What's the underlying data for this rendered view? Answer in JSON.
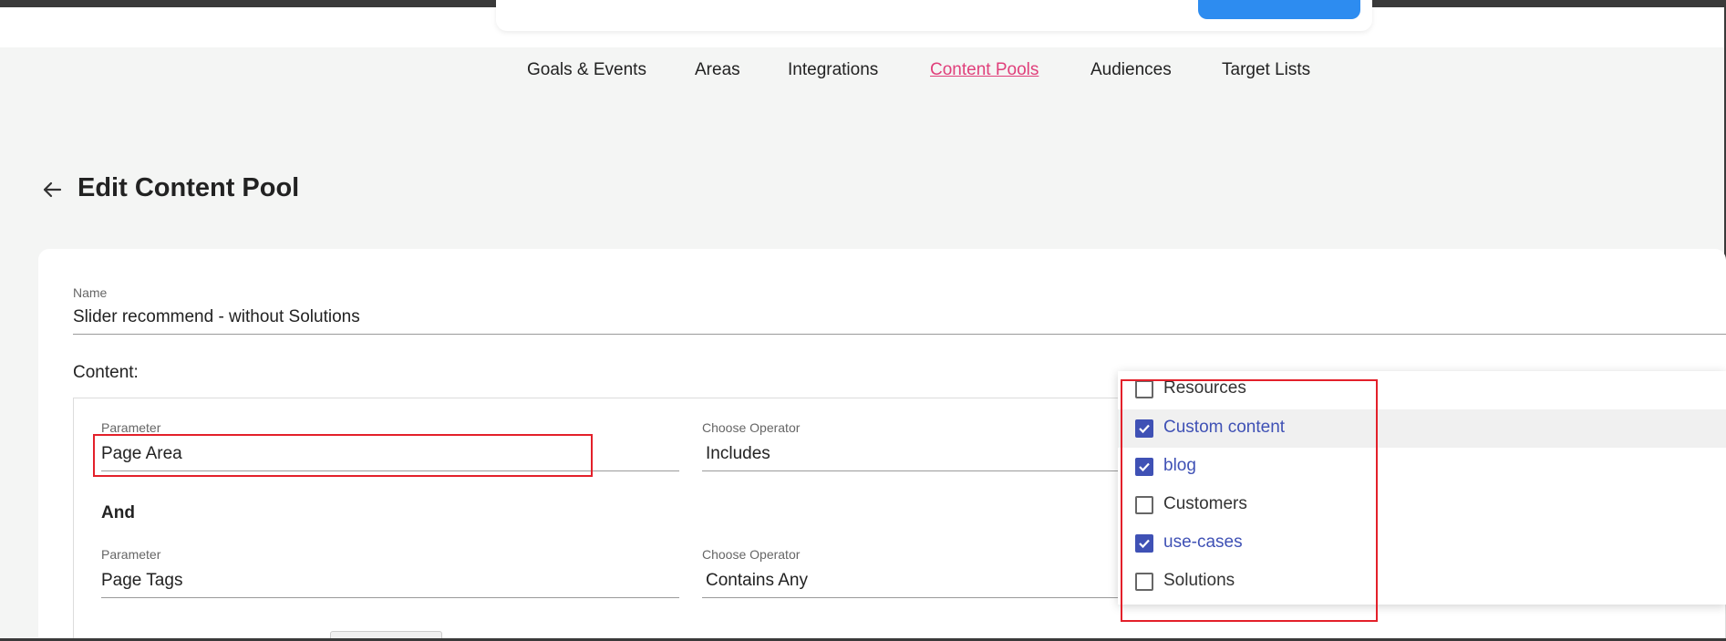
{
  "nav": {
    "items": [
      {
        "label": "Goals & Events",
        "active": false
      },
      {
        "label": "Areas",
        "active": false
      },
      {
        "label": "Integrations",
        "active": false
      },
      {
        "label": "Content Pools",
        "active": true
      },
      {
        "label": "Audiences",
        "active": false
      },
      {
        "label": "Target Lists",
        "active": false
      }
    ]
  },
  "header": {
    "title": "Edit Content Pool",
    "back_icon": "arrow-left-icon"
  },
  "form": {
    "name_label": "Name",
    "name_value": "Slider recommend - without Solutions",
    "content_label": "Content:",
    "rule1": {
      "parameter_label": "Parameter",
      "parameter_value": "Page Area",
      "operator_label": "Choose Operator",
      "operator_value": "Includes"
    },
    "and_label": "And",
    "rule2": {
      "parameter_label": "Parameter",
      "parameter_value": "Page Tags",
      "operator_label": "Choose Operator",
      "operator_value": "Contains Any"
    }
  },
  "dropdown": {
    "options": [
      {
        "label": "Resources",
        "checked": false
      },
      {
        "label": "Custom content",
        "checked": true
      },
      {
        "label": "blog",
        "checked": true
      },
      {
        "label": "Customers",
        "checked": false
      },
      {
        "label": "use-cases",
        "checked": true
      },
      {
        "label": "Solutions",
        "checked": false
      }
    ]
  },
  "colors": {
    "accent_pink": "#e0407b",
    "checkbox_blue": "#3f51b5",
    "annotation_red": "#e3202a",
    "top_button_blue": "#2d8cf0"
  }
}
